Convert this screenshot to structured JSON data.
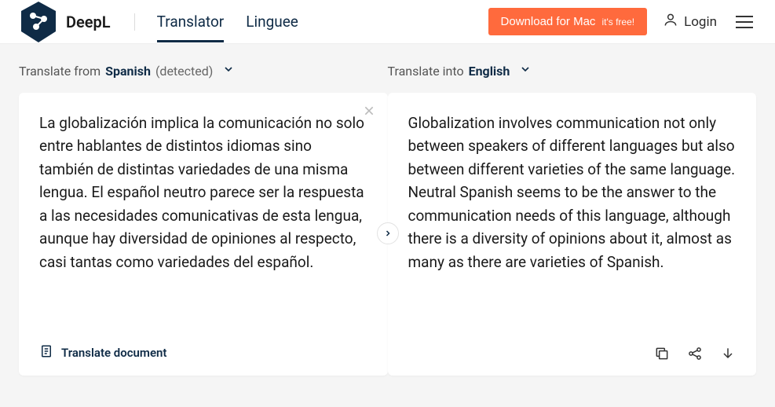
{
  "header": {
    "brand": "DeepL",
    "tabs": {
      "translator": "Translator",
      "linguee": "Linguee"
    },
    "download": {
      "label": "Download for Mac",
      "badge": "it's free!"
    },
    "login": "Login"
  },
  "source": {
    "prefix": "Translate from",
    "language": "Spanish",
    "suffix": "(detected)",
    "text": "La globalización implica la comunicación no solo entre hablantes de distintos idiomas sino también de distintas variedades de una misma lengua. El español neutro parece ser la respuesta a las necesidades comunicativas de esta lengua, aunque hay diversidad de opiniones al respecto, casi tantas como variedades del español.",
    "translate_document": "Translate document"
  },
  "target": {
    "prefix": "Translate into",
    "language": "English",
    "text": "Globalization involves communication not only between speakers of different languages but also between different varieties of the same language. Neutral Spanish seems to be the answer to the communication needs of this language, although there is a diversity of opinions about it, almost as many as there are varieties of Spanish."
  }
}
